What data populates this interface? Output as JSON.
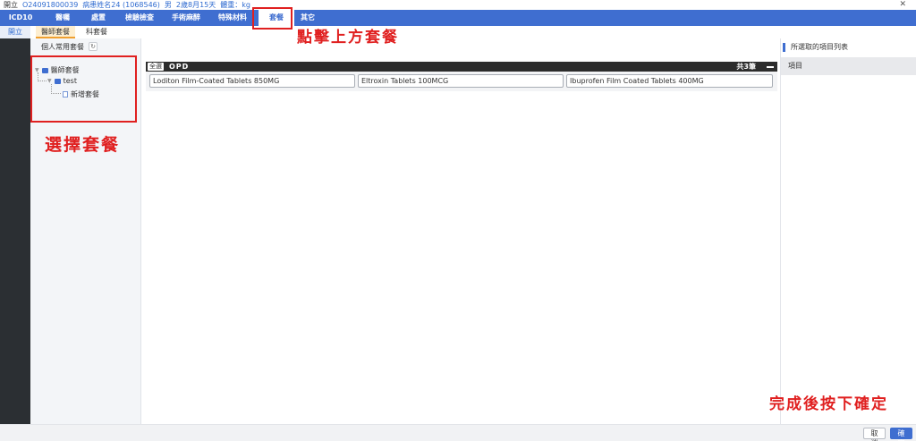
{
  "patient": {
    "dept": "開立",
    "record_id": "O24091800039",
    "name": "病患姓名24 (1068546)",
    "gender": "男",
    "age": "2歲8月15天",
    "weight": "體重：kg"
  },
  "main_tabs": [
    "ICD10",
    "醫囑",
    "處置",
    "檢驗檢查",
    "手術麻醉",
    "特殊材料",
    "套餐",
    "其它"
  ],
  "active_tab": "套餐",
  "left_nav": {
    "item": "開立"
  },
  "sub_tabs": [
    "醫師套餐",
    "科套餐"
  ],
  "tree": {
    "header": "個人常用套餐",
    "refresh_glyph": "↻",
    "root": "醫師套餐",
    "child": "test",
    "leaf": "新增套餐"
  },
  "package": {
    "select_all": "全選",
    "name": "OPD",
    "count": "共3筆"
  },
  "drugs": [
    "Loditon Film-Coated Tablets 850MG",
    "Eltroxin Tablets 100MCG",
    "Ibuprofen Film Coated Tablets 400MG"
  ],
  "right_panel": {
    "title": "所選取的項目列表",
    "column": "項目"
  },
  "footer": {
    "cancel": "取消",
    "confirm": "確定"
  },
  "annotations": {
    "top": "點擊上方套餐",
    "left": "選擇套餐",
    "bottom": "完成後按下確定"
  },
  "colors": {
    "accent": "#3f6ed0",
    "annotation": "#e02020"
  }
}
